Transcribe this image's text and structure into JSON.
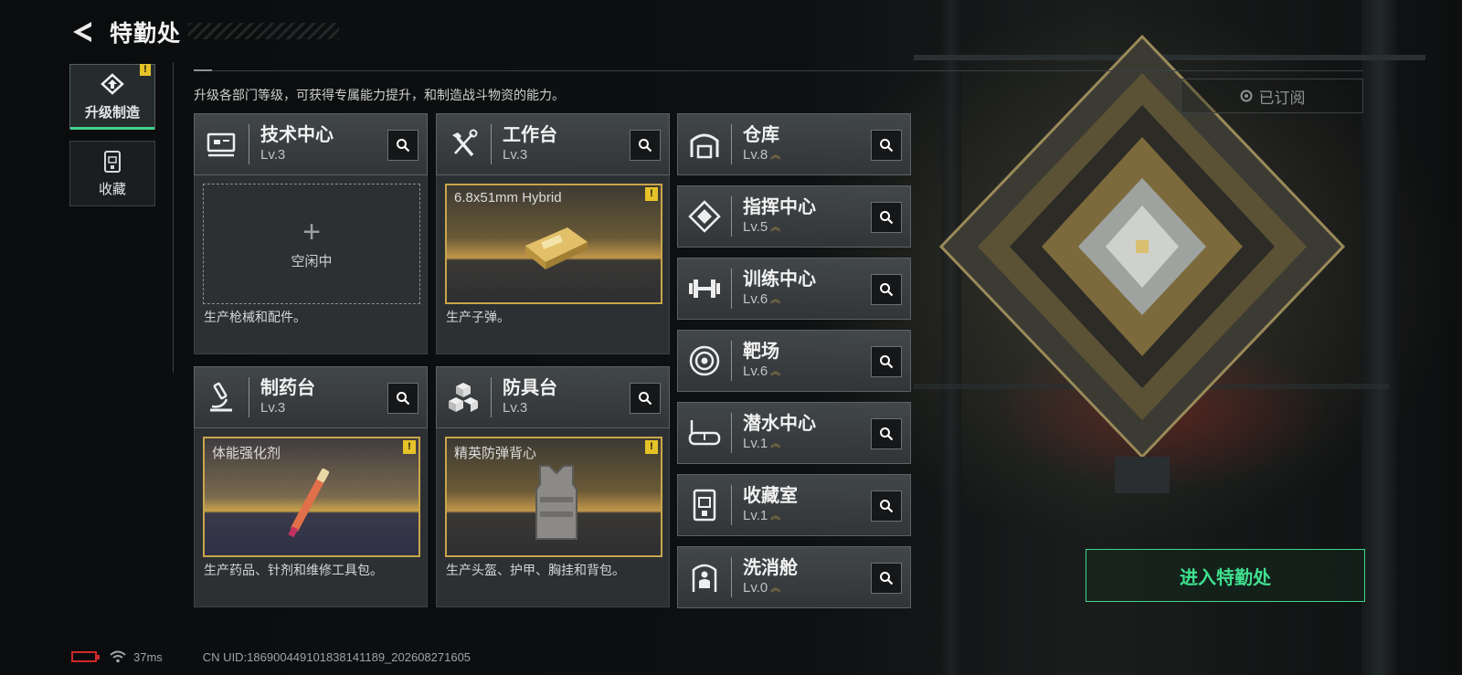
{
  "header": {
    "title": "特勤处"
  },
  "tabs": [
    {
      "label": "升级制造",
      "active": true,
      "alert": "!"
    },
    {
      "label": "收藏",
      "active": false
    }
  ],
  "description": "升级各部门等级，可获得专属能力提升，和制造战斗物资的能力。",
  "subscribed_label": "已订阅",
  "enter_button": "进入特勤处",
  "workshops": [
    {
      "name": "技术中心",
      "level": "Lv.3",
      "icon": "monitor-icon",
      "slot": {
        "state": "idle",
        "plus": "+",
        "text": "空闲中"
      },
      "footer": "生产枪械和配件。"
    },
    {
      "name": "工作台",
      "level": "Lv.3",
      "icon": "tools-icon",
      "slot": {
        "state": "producing",
        "item": "6.8x51mm Hybrid",
        "alert": "!"
      },
      "footer": "生产子弹。"
    },
    {
      "name": "制药台",
      "level": "Lv.3",
      "icon": "microscope-icon",
      "slot": {
        "state": "producing",
        "item": "体能强化剂",
        "alert": "!"
      },
      "footer": "生产药品、针剂和维修工具包。"
    },
    {
      "name": "防具台",
      "level": "Lv.3",
      "icon": "blocks-icon",
      "slot": {
        "state": "producing",
        "item": "精英防弹背心",
        "alert": "!"
      },
      "footer": "生产头盔、护甲、胸挂和背包。"
    }
  ],
  "facilities": [
    {
      "name": "仓库",
      "level": "Lv.8",
      "icon": "warehouse-icon",
      "upgrade": "︽"
    },
    {
      "name": "指挥中心",
      "level": "Lv.5",
      "icon": "command-icon",
      "upgrade": "︽"
    },
    {
      "name": "训练中心",
      "level": "Lv.6",
      "icon": "dumbbell-icon",
      "upgrade": "︽"
    },
    {
      "name": "靶场",
      "level": "Lv.6",
      "icon": "target-icon",
      "upgrade": "︽"
    },
    {
      "name": "潜水中心",
      "level": "Lv.1",
      "icon": "diving-mask-icon",
      "upgrade": "︽"
    },
    {
      "name": "收藏室",
      "level": "Lv.1",
      "icon": "collection-icon",
      "upgrade": "︽"
    },
    {
      "name": "洗消舱",
      "level": "Lv.0",
      "icon": "decon-icon",
      "upgrade": "︽"
    }
  ],
  "status": {
    "ping": "37ms",
    "uid": "CN UID:1869004491018381​41189_202608271605"
  },
  "colors": {
    "accent_green": "#3fd68a",
    "alert_yellow": "#e6c328",
    "gold": "#c9a54b",
    "battery_red": "#d02828"
  }
}
